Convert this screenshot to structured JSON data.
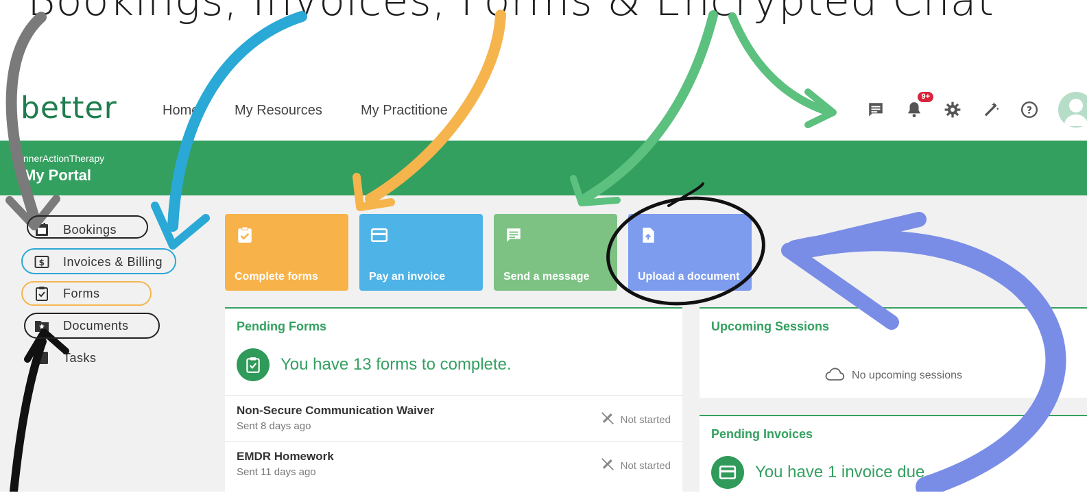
{
  "banner": {
    "title": "Bookings, Invoices, Forms & Encrypted Chat"
  },
  "header": {
    "logo": "better",
    "nav": [
      "Home",
      "My Resources",
      "My Practitione"
    ],
    "notifications_badge": "9+"
  },
  "portal": {
    "org": "InnerActionTherapy",
    "title": "My Portal"
  },
  "sidebar": {
    "items": [
      {
        "label": "Bookings",
        "icon": "calendar-icon"
      },
      {
        "label": "Invoices & Billing",
        "icon": "dollar-icon"
      },
      {
        "label": "Forms",
        "icon": "clipboard-check-icon"
      },
      {
        "label": "Documents",
        "icon": "folder-star-icon"
      },
      {
        "label": "Tasks",
        "icon": "task-icon"
      }
    ]
  },
  "tiles": [
    {
      "label": "Complete forms",
      "color": "#f7b24a",
      "icon": "clipboard-check-icon"
    },
    {
      "label": "Pay an invoice",
      "color": "#4eb3e6",
      "icon": "credit-card-icon"
    },
    {
      "label": "Send a message",
      "color": "#7dc283",
      "icon": "message-icon"
    },
    {
      "label": "Upload a document",
      "color": "#7d9cee",
      "icon": "file-upload-icon"
    }
  ],
  "pending_forms": {
    "title": "Pending Forms",
    "summary": "You have 13 forms to complete.",
    "rows": [
      {
        "name": "Non-Secure Communication Waiver",
        "sent": "Sent 8 days ago",
        "status": "Not started"
      },
      {
        "name": "EMDR Homework",
        "sent": "Sent 11 days ago",
        "status": "Not started"
      }
    ]
  },
  "upcoming_sessions": {
    "title": "Upcoming Sessions",
    "empty": "No upcoming sessions"
  },
  "pending_invoices": {
    "title": "Pending Invoices",
    "summary": "You have 1 invoice due."
  },
  "colors": {
    "brand": "#34a060",
    "badge": "#d8253b"
  }
}
